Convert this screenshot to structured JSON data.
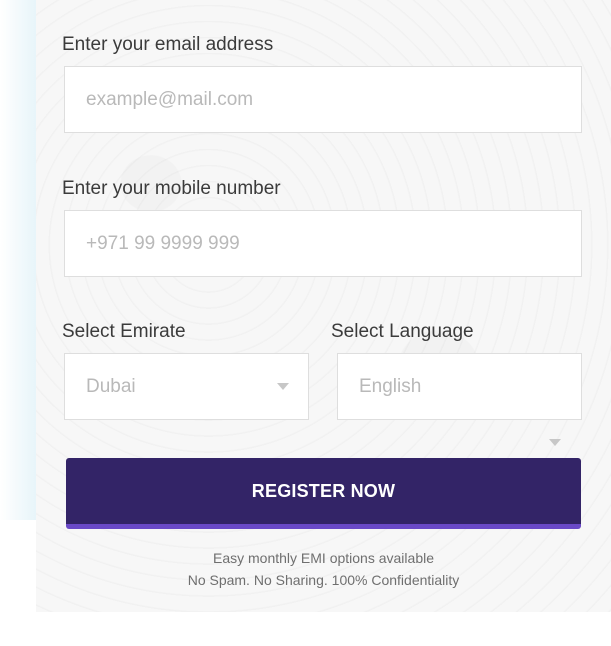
{
  "email": {
    "label": "Enter your email address",
    "placeholder": "example@mail.com",
    "value": ""
  },
  "mobile": {
    "label": "Enter your mobile number",
    "placeholder": "+971 99 9999 999",
    "value": ""
  },
  "emirate": {
    "label": "Select Emirate",
    "selected": "Dubai"
  },
  "language": {
    "label": "Select Language",
    "selected": "English"
  },
  "register_button": "REGISTER NOW",
  "notes": {
    "line1": "Easy monthly EMI options available",
    "line2": "No Spam. No Sharing. 100% Confidentiality"
  },
  "colors": {
    "button": "#332467",
    "button_accent": "#6a49c7",
    "card_background": "#f7f7f7"
  }
}
